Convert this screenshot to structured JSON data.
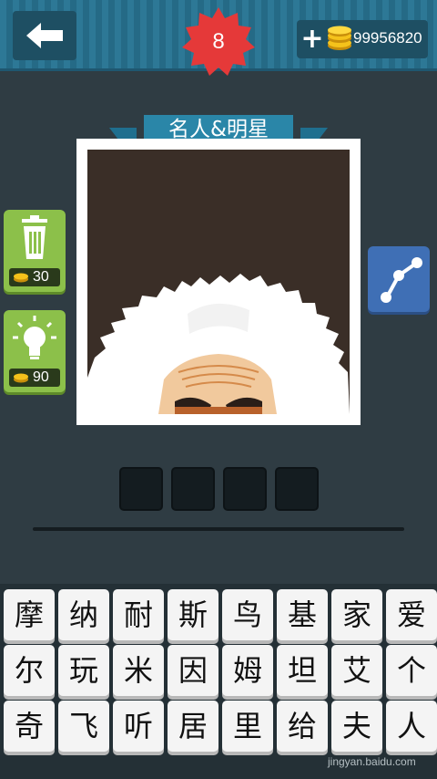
{
  "header": {
    "level": "8",
    "coins": "99956820"
  },
  "category": "名人&明星",
  "tools": [
    {
      "name": "remove",
      "price": "30"
    },
    {
      "name": "hint",
      "price": "90"
    }
  ],
  "answer_slots": 4,
  "keyboard": {
    "rows": [
      [
        "摩",
        "纳",
        "耐",
        "斯",
        "鸟",
        "基",
        "家",
        "爱"
      ],
      [
        "尔",
        "玩",
        "米",
        "因",
        "姆",
        "坦",
        "艾",
        "个"
      ],
      [
        "奇",
        "飞",
        "听",
        "居",
        "里",
        "给",
        "夫",
        "人"
      ]
    ]
  },
  "watermark": "jingyan.baidu.com",
  "colors": {
    "header": "#2d7896",
    "badge": "#e53939",
    "tool_green": "#8cc04a",
    "share_blue": "#3f6fb5"
  }
}
